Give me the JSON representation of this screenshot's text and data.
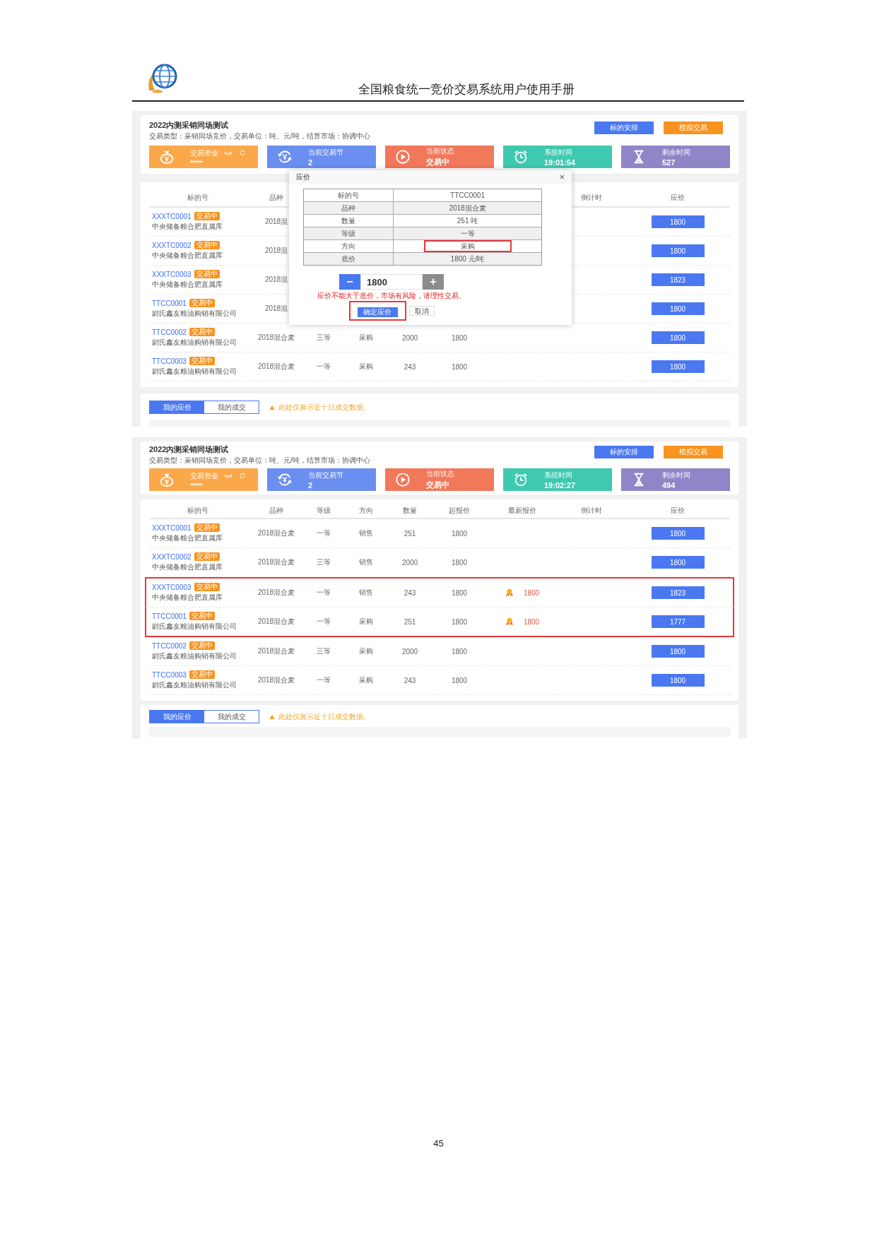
{
  "document": {
    "title": "全国粮食统一竞价交易系统用户使用手册",
    "page_number": "45"
  },
  "screens": [
    {
      "title": "2022内测采销同场测试",
      "subtitle": "交易类型：采销同场竞价，交易单位：吨、元/吨，结算市场：协调中心",
      "buttons": [
        {
          "label": "标的安排",
          "color": "#4a78f0"
        },
        {
          "label": "模拟交易",
          "color": "#f7931e"
        }
      ],
      "cards": [
        {
          "kind": "funds",
          "label": "交易资金",
          "value": "*****",
          "color": "#fba84b"
        },
        {
          "kind": "session",
          "label": "当前交易节",
          "value": "2",
          "color": "#6b8ff0"
        },
        {
          "kind": "state",
          "label": "当前状态",
          "value": "交易中",
          "color": "#f2785a"
        },
        {
          "kind": "time",
          "label": "系统时间",
          "value": "19:01:54",
          "color": "#3ec9b0"
        },
        {
          "kind": "remaining",
          "label": "剩余时间",
          "value": "527",
          "color": "#8f86c8"
        }
      ],
      "table": {
        "headers": {
          "code": "标的号",
          "variety": "品种",
          "countdown": "倒计时",
          "bid": "应价"
        },
        "rows": [
          {
            "code": "XXXTC0001",
            "status": "交易中",
            "company": "中央储备粮合肥直属库",
            "variety": "2018混",
            "bid": "1800",
            "highlighted": false
          },
          {
            "code": "XXXTC0002",
            "status": "交易中",
            "company": "中央储备粮合肥直属库",
            "variety": "2018混",
            "bid": "1800",
            "highlighted": false
          },
          {
            "code": "XXXTC0003",
            "status": "交易中",
            "company": "中央储备粮合肥直属库",
            "variety": "2018混",
            "bid": "1823",
            "highlighted": false
          },
          {
            "code": "TTCC0001",
            "status": "交易中",
            "company": "尉氏鑫友粮油购销有限公司",
            "variety": "2018混",
            "bid": "1800",
            "highlighted": false
          },
          {
            "code": "TTCC0002",
            "status": "交易中",
            "company": "尉氏鑫友粮油购销有限公司",
            "variety": "2018混合麦",
            "grade": "三等",
            "direction": "采购",
            "quantity": "2000",
            "start_price": "1800",
            "bid": "1800",
            "highlighted": false
          },
          {
            "code": "TTCC0003",
            "status": "交易中",
            "company": "尉氏鑫友粮油购销有限公司",
            "variety": "2018混合麦",
            "grade": "一等",
            "direction": "采购",
            "quantity": "243",
            "start_price": "1800",
            "bid": "1800",
            "highlighted": false
          }
        ]
      },
      "tabs": [
        {
          "label": "我的应价",
          "selected": true
        },
        {
          "label": "我的成交",
          "selected": false
        }
      ],
      "notice": "此处仅展示近十日成交数据。",
      "modal": {
        "title": "应价",
        "close": "×",
        "fields": [
          {
            "label": "标的号",
            "value": "TTCC0001",
            "highlighted": false
          },
          {
            "label": "品种",
            "value": "2018混合麦",
            "highlighted": false
          },
          {
            "label": "数量",
            "value": "251 吨",
            "highlighted": false
          },
          {
            "label": "等级",
            "value": "一等",
            "highlighted": false
          },
          {
            "label": "方向",
            "value": "采购",
            "highlighted": true
          },
          {
            "label": "底价",
            "value": "1800 元/吨",
            "highlighted": false
          }
        ],
        "minus": "−",
        "price": "1800",
        "plus": "+",
        "warning": "应价不能大于底价，市场有风险，请理性交易。",
        "confirm": {
          "label": "确定应价",
          "highlighted": true
        },
        "cancel": "取消"
      }
    },
    {
      "title": "2022内测采销同场测试",
      "subtitle": "交易类型：采销同场竞价，交易单位：吨、元/吨，结算市场：协调中心",
      "buttons": [
        {
          "label": "标的安排",
          "color": "#4a78f0"
        },
        {
          "label": "模拟交易",
          "color": "#f7931e"
        }
      ],
      "cards": [
        {
          "kind": "funds",
          "label": "交易资金",
          "value": "*****",
          "color": "#fba84b"
        },
        {
          "kind": "session",
          "label": "当前交易节",
          "value": "2",
          "color": "#6b8ff0"
        },
        {
          "kind": "state",
          "label": "当前状态",
          "value": "交易中",
          "color": "#f2785a"
        },
        {
          "kind": "time",
          "label": "系统时间",
          "value": "19:02:27",
          "color": "#3ec9b0"
        },
        {
          "kind": "remaining",
          "label": "剩余时间",
          "value": "494",
          "color": "#8f86c8"
        }
      ],
      "table": {
        "headers": {
          "code": "标的号",
          "variety": "品种",
          "grade": "等级",
          "direction": "方向",
          "quantity": "数量",
          "start_price": "起报价",
          "latest_price": "最新报价",
          "countdown": "倒计时",
          "bid": "应价"
        },
        "rows": [
          {
            "code": "XXXTC0001",
            "status": "交易中",
            "company": "中央储备粮合肥直属库",
            "variety": "2018混合麦",
            "grade": "一等",
            "direction": "销售",
            "quantity": "251",
            "start_price": "1800",
            "bid": "1800",
            "award": false,
            "highlighted": false
          },
          {
            "code": "XXXTC0002",
            "status": "交易中",
            "company": "中央储备粮合肥直属库",
            "variety": "2018混合麦",
            "grade": "三等",
            "direction": "销售",
            "quantity": "2000",
            "start_price": "1800",
            "bid": "1800",
            "award": false,
            "highlighted": false
          },
          {
            "code": "XXXTC0003",
            "status": "交易中",
            "company": "中央储备粮合肥直属库",
            "variety": "2018混合麦",
            "grade": "一等",
            "direction": "销售",
            "quantity": "243",
            "start_price": "1800",
            "latest_price": "1800",
            "bid": "1823",
            "award": true,
            "highlighted": true
          },
          {
            "code": "TTCC0001",
            "status": "交易中",
            "company": "尉氏鑫友粮油购销有限公司",
            "variety": "2018混合麦",
            "grade": "一等",
            "direction": "采购",
            "quantity": "251",
            "start_price": "1800",
            "latest_price": "1800",
            "bid": "1777",
            "award": true,
            "highlighted": true
          },
          {
            "code": "TTCC0002",
            "status": "交易中",
            "company": "尉氏鑫友粮油购销有限公司",
            "variety": "2018混合麦",
            "grade": "三等",
            "direction": "采购",
            "quantity": "2000",
            "start_price": "1800",
            "bid": "1800",
            "award": false,
            "highlighted": false
          },
          {
            "code": "TTCC0003",
            "status": "交易中",
            "company": "尉氏鑫友粮油购销有限公司",
            "variety": "2018混合麦",
            "grade": "一等",
            "direction": "采购",
            "quantity": "243",
            "start_price": "1800",
            "bid": "1800",
            "award": false,
            "highlighted": false
          }
        ]
      },
      "tabs": [
        {
          "label": "我的应价",
          "selected": true
        },
        {
          "label": "我的成交",
          "selected": false
        }
      ],
      "notice": "此处仅展示近十日成交数据。"
    }
  ]
}
